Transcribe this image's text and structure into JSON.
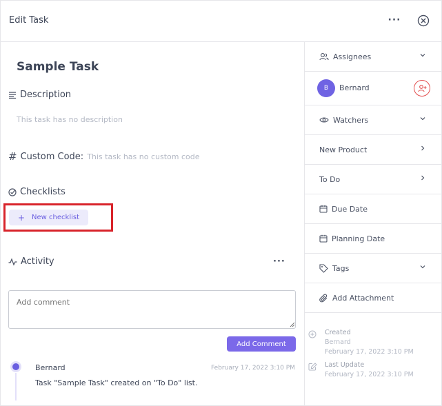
{
  "header": {
    "title": "Edit Task",
    "more_label": "···"
  },
  "task": {
    "title": "Sample Task",
    "description_label": "Description",
    "description_placeholder": "This task has no description",
    "custom_code_label": "Custom Code:",
    "custom_code_placeholder": "This task has no custom code",
    "checklists_label": "Checklists",
    "new_checklist_label": "New checklist"
  },
  "activity": {
    "label": "Activity",
    "more_label": "···",
    "comment_placeholder": "Add comment",
    "add_comment_label": "Add Comment",
    "entries": [
      {
        "user": "Bernard",
        "time": "February 17, 2022 3:10 PM",
        "message": "Task \"Sample Task\" created on \"To Do\" list."
      }
    ]
  },
  "sidebar": {
    "assignees_label": "Assignees",
    "assignee": {
      "initial": "B",
      "name": "Bernard"
    },
    "watchers_label": "Watchers",
    "project_label": "New Product",
    "list_label": "To Do",
    "due_date_label": "Due Date",
    "planning_date_label": "Planning Date",
    "tags_label": "Tags",
    "attachment_label": "Add Attachment",
    "created_label": "Created",
    "created_by": "Bernard",
    "created_at": "February 17, 2022 3:10 PM",
    "updated_label": "Last Update",
    "updated_at": "February 17, 2022 3:10 PM"
  },
  "colors": {
    "accent": "#7b69e9",
    "highlight": "#d8232a",
    "danger": "#e34c4c"
  }
}
